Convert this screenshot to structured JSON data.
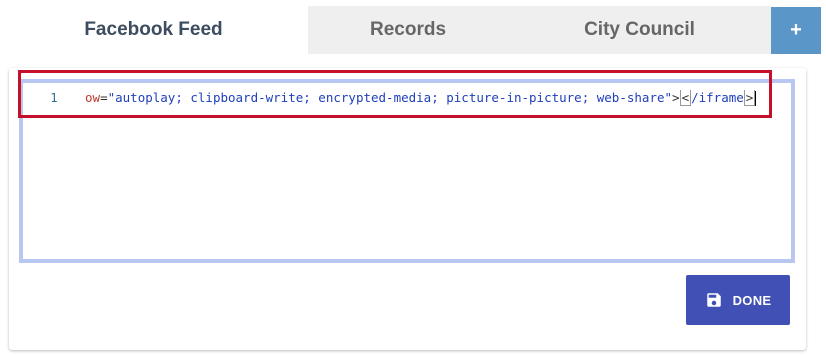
{
  "tabs": {
    "items": [
      {
        "label": "Facebook Feed"
      },
      {
        "label": "Records"
      },
      {
        "label": "City Council"
      }
    ],
    "add_label": "+"
  },
  "editor": {
    "line_number": "1",
    "code": {
      "attr_fragment": "ow",
      "equals": "=",
      "value": "\"autoplay; clipboard-write; encrypted-media; picture-in-picture; web-share\"",
      "close_bracket": ">",
      "open_bracket": "<",
      "closing_tag": "/iframe",
      "end_bracket": ">"
    }
  },
  "actions": {
    "done_label": "DONE",
    "done_icon": "save-icon"
  },
  "colors": {
    "highlight": "#c4102b",
    "editor_border": "#b7c7f2",
    "done_button": "#4050b5",
    "add_tab": "#5b96c8"
  }
}
